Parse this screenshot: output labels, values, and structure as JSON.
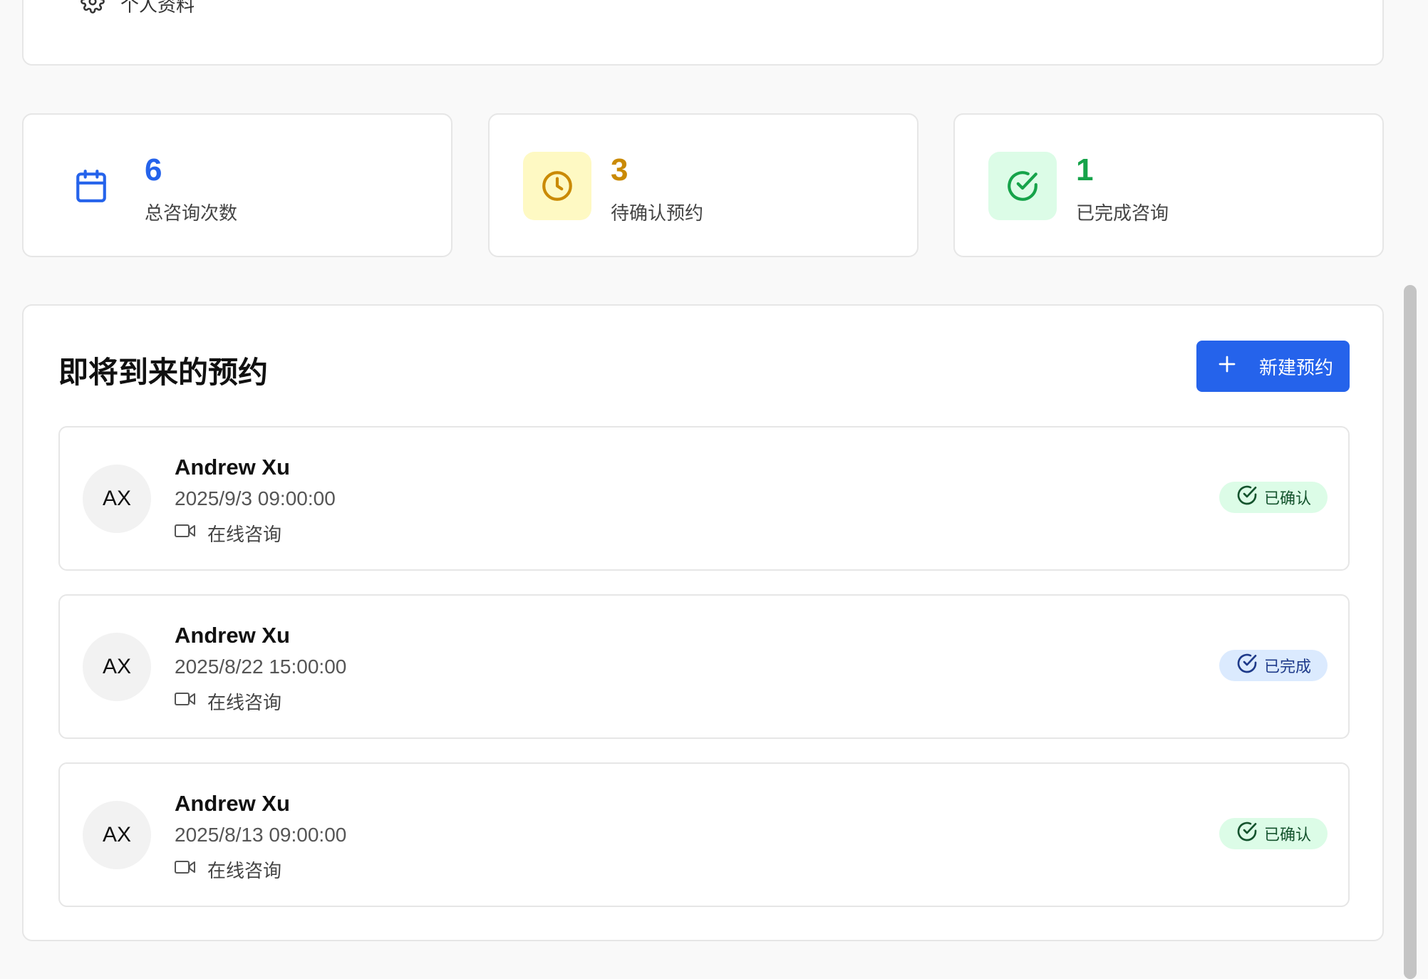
{
  "nav": {
    "profile_label": "个人资料",
    "profile_icon": "gear-icon"
  },
  "stats": [
    {
      "value": "6",
      "label": "总咨询次数",
      "icon": "calendar-icon",
      "color": "#2563eb",
      "bg": "#ffffff"
    },
    {
      "value": "3",
      "label": "待确认预约",
      "icon": "clock-icon",
      "color": "#ca8a04",
      "bg": "#fef9c3"
    },
    {
      "value": "1",
      "label": "已完成咨询",
      "icon": "check-circle-icon",
      "color": "#16a34a",
      "bg": "#dcfce7"
    }
  ],
  "appointments_section": {
    "title": "即将到来的预约",
    "new_button_label": "新建预约",
    "items": [
      {
        "initials": "AX",
        "name": "Andrew Xu",
        "datetime": "2025/9/3 09:00:00",
        "type": "在线咨询",
        "status": "已确认",
        "status_color": "green"
      },
      {
        "initials": "AX",
        "name": "Andrew Xu",
        "datetime": "2025/8/22 15:00:00",
        "type": "在线咨询",
        "status": "已完成",
        "status_color": "blue"
      },
      {
        "initials": "AX",
        "name": "Andrew Xu",
        "datetime": "2025/8/13 09:00:00",
        "type": "在线咨询",
        "status": "已确认",
        "status_color": "green"
      }
    ]
  },
  "colors": {
    "accent": "#2563eb",
    "border": "#e6e6e6",
    "background": "#f9f9f9"
  }
}
